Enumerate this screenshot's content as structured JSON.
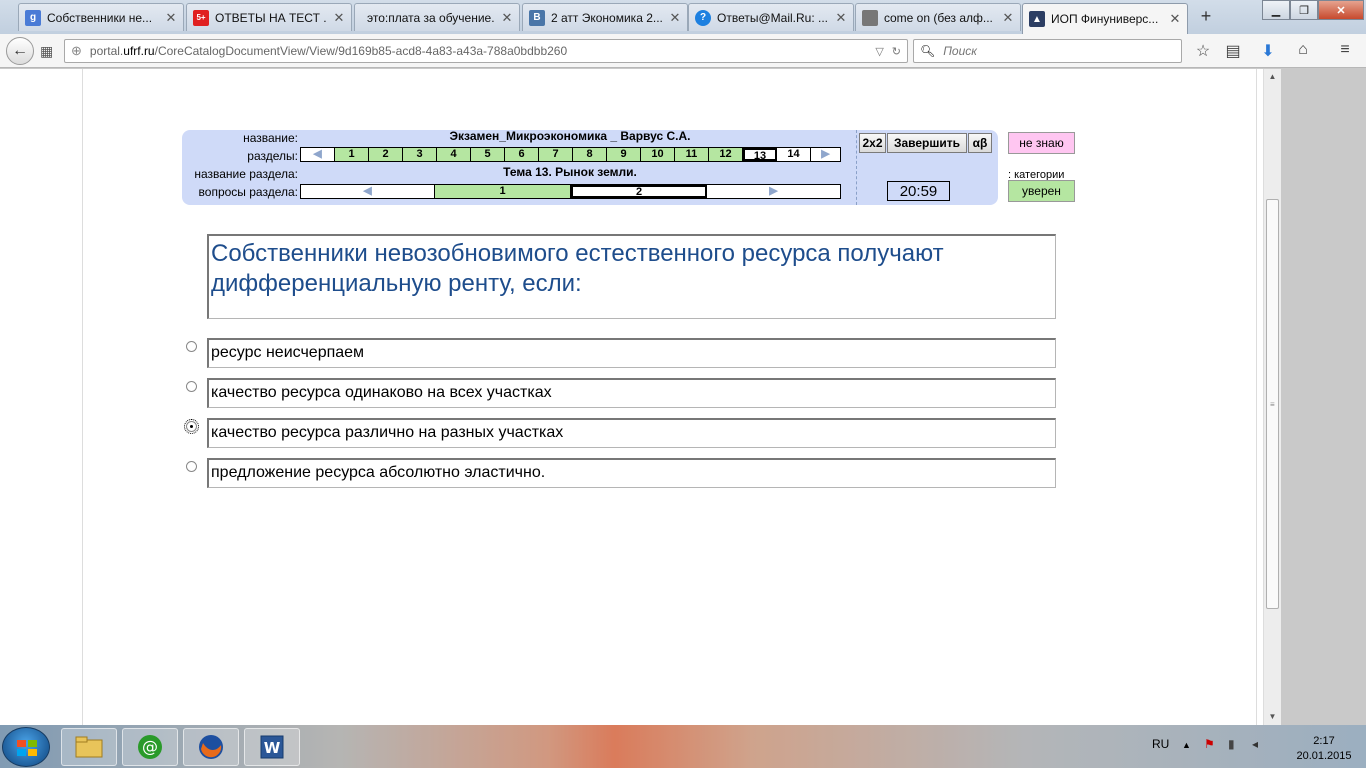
{
  "browser": {
    "tabs": [
      {
        "label": "Собственники не...",
        "favicon_color": "#4a7bd6",
        "favicon_glyph": "g"
      },
      {
        "label": "ОТВЕТЫ НА ТЕСТ ...",
        "favicon_color": "#e02020",
        "favicon_glyph": "5+"
      },
      {
        "label": "это:плата за обучение...",
        "favicon_color": "",
        "favicon_glyph": ""
      },
      {
        "label": "2 атт Экономика 2...",
        "favicon_color": "#4a76a8",
        "favicon_glyph": "B"
      },
      {
        "label": "Ответы@Mail.Ru: ...",
        "favicon_color": "#1d80e0",
        "favicon_glyph": "?"
      },
      {
        "label": "come on (без алф...",
        "favicon_color": "#777777",
        "favicon_glyph": ""
      },
      {
        "label": "ИОП Финуниверс...",
        "favicon_color": "#2c3e63",
        "favicon_glyph": "▲"
      }
    ],
    "url_prefix": "portal.",
    "url_domain": "ufrf.ru",
    "url_path": "/CoreCatalogDocumentView/View/9d169b85-acd8-4a83-a43a-788a0bdbb260",
    "search_placeholder": "Поиск"
  },
  "exam": {
    "label_name": "название:",
    "label_sections": "разделы:",
    "label_section_name": "название раздела:",
    "label_section_questions": "вопросы раздела:",
    "title": "Экзамен_Микроэкономика _ Варвус С.А.",
    "sections": [
      "1",
      "2",
      "3",
      "4",
      "5",
      "6",
      "7",
      "8",
      "9",
      "10",
      "11",
      "12",
      "13",
      "14"
    ],
    "current_section": "13",
    "section_title": "Тема 13. Рынок земли.",
    "questions": [
      "1",
      "2"
    ],
    "btn_2x2": "2x2",
    "btn_finish": "Завершить",
    "btn_ab": "αβ",
    "timer": "20:59",
    "btn_dont_know": "не знаю",
    "categories_label": "категории",
    "btn_sure": "уверен"
  },
  "question": {
    "text": "Собственники невозобновимого естественного ресурса получают дифференциальную ренту, если:",
    "answers": [
      "ресурс неисчерпаем",
      "качество ресурса одинаково на всех участках",
      "качество ресурса различно на разных участках",
      "предложение ресурса абсолютно эластично."
    ],
    "selected_index": 2
  },
  "taskbar": {
    "language": "RU",
    "time": "2:17",
    "date": "20.01.2015"
  }
}
